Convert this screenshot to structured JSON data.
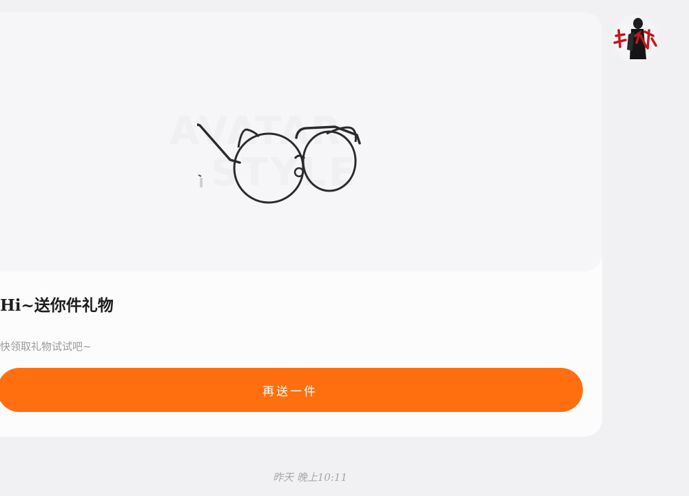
{
  "message": {
    "gift_title": "Hi~送你件礼物",
    "gift_subtitle": "快领取礼物试试吧~",
    "send_button_label": "再送一件",
    "image_watermark": "AVATAR",
    "image_watermark_line2": "STYLE",
    "gift_image_icon": "round-glasses-with-cat-ears",
    "timestamp": "昨天 晚上10:11"
  },
  "sender": {
    "avatar_text": "快点",
    "avatar_icon": "user-avatar"
  },
  "colors": {
    "accent": "#ff6f0f",
    "background": "#f1f1f3",
    "card": "#fcfcfd",
    "avatar_text": "#c4161c"
  }
}
